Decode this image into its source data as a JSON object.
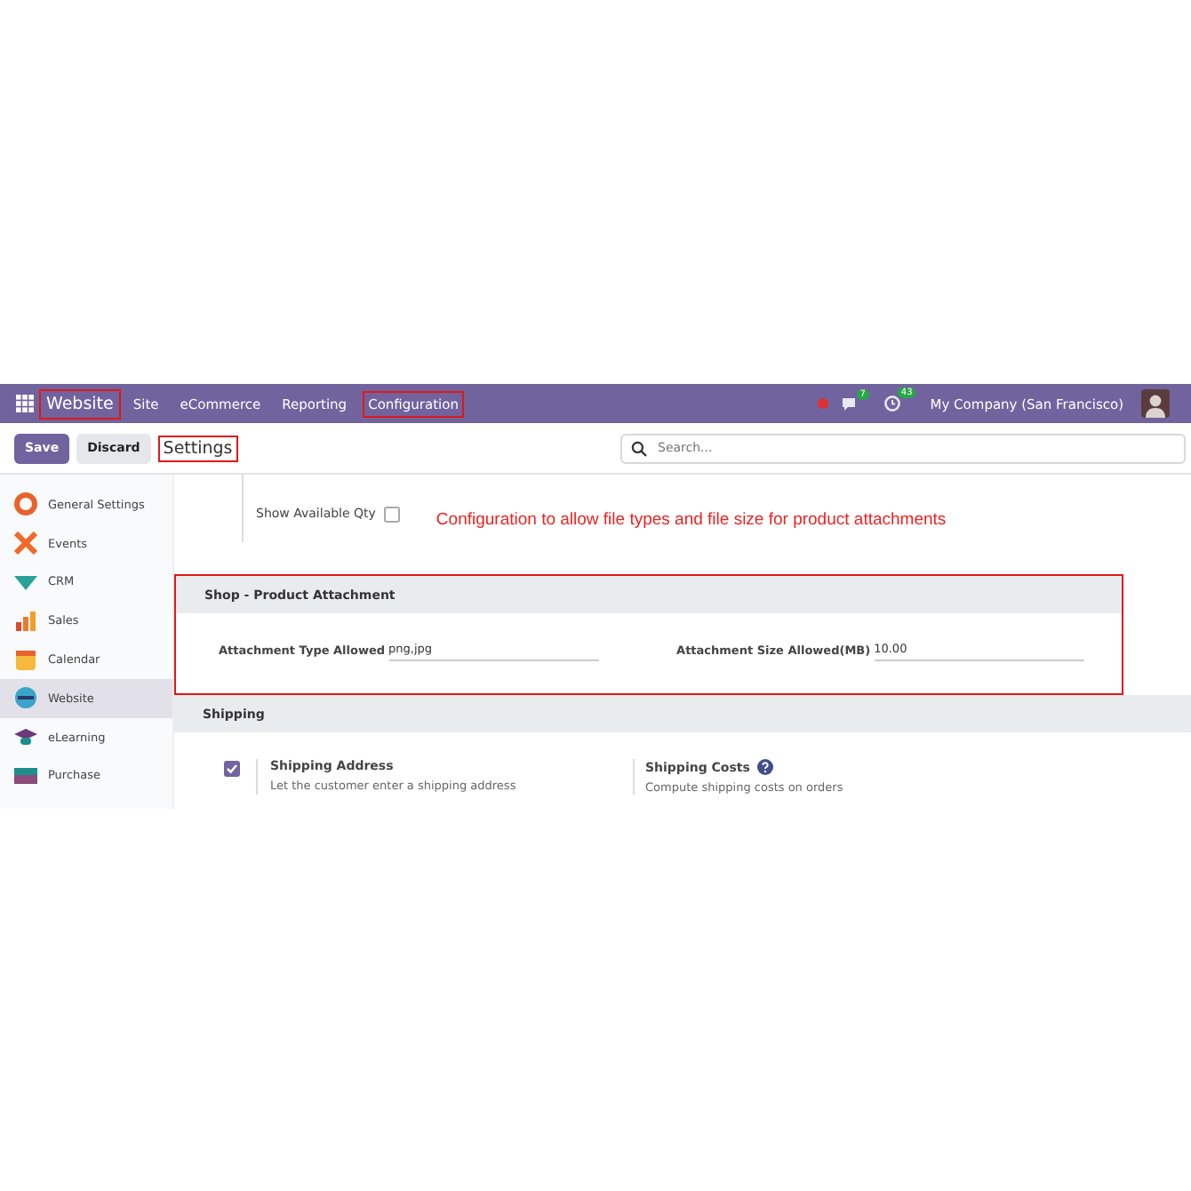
{
  "navbar": {
    "app_name": "Website",
    "app_highlighted": true,
    "menu": [
      {
        "label": "Site",
        "highlighted": false
      },
      {
        "label": "eCommerce",
        "highlighted": false
      },
      {
        "label": "Reporting",
        "highlighted": false
      },
      {
        "label": "Configuration",
        "highlighted": true
      }
    ],
    "messages_count": "7",
    "activities_count": "43",
    "company": "My Company (San Francisco)"
  },
  "control_bar": {
    "buttons": [
      {
        "label": "Save",
        "kind": "primary"
      },
      {
        "label": "Discard",
        "kind": "secondary"
      }
    ],
    "breadcrumb": "Settings",
    "breadcrumb_highlighted": true,
    "search": {
      "placeholder": "Search..."
    }
  },
  "sidebar": {
    "items": [
      {
        "label": "General Settings",
        "selected": false
      },
      {
        "label": "Events",
        "selected": false
      },
      {
        "label": "CRM",
        "selected": false
      },
      {
        "label": "Sales",
        "selected": false
      },
      {
        "label": "Calendar",
        "selected": false
      },
      {
        "label": "Website",
        "selected": true
      },
      {
        "label": "eLearning",
        "selected": false
      },
      {
        "label": "Purchase",
        "selected": false
      }
    ]
  },
  "top_setting": {
    "label": "Show Available Qty",
    "checked": false
  },
  "annotation": "Configuration to allow file types and file size for product attachments",
  "sections": [
    {
      "title": "Shop - Product Attachment",
      "highlighted": true,
      "kind": "fields",
      "fields": [
        {
          "label": "Attachment Type Allowed",
          "value": "png,jpg"
        },
        {
          "label": "Attachment Size Allowed(MB)",
          "value": "10.00"
        }
      ]
    },
    {
      "title": "Shipping",
      "highlighted": false,
      "kind": "settings",
      "settings": [
        {
          "kind": "checkbox",
          "title": "Shipping Address",
          "description": "Let the customer enter a shipping address",
          "checked": true
        },
        {
          "kind": "help",
          "title": "Shipping Costs",
          "description": "Compute shipping costs on orders"
        }
      ]
    }
  ]
}
